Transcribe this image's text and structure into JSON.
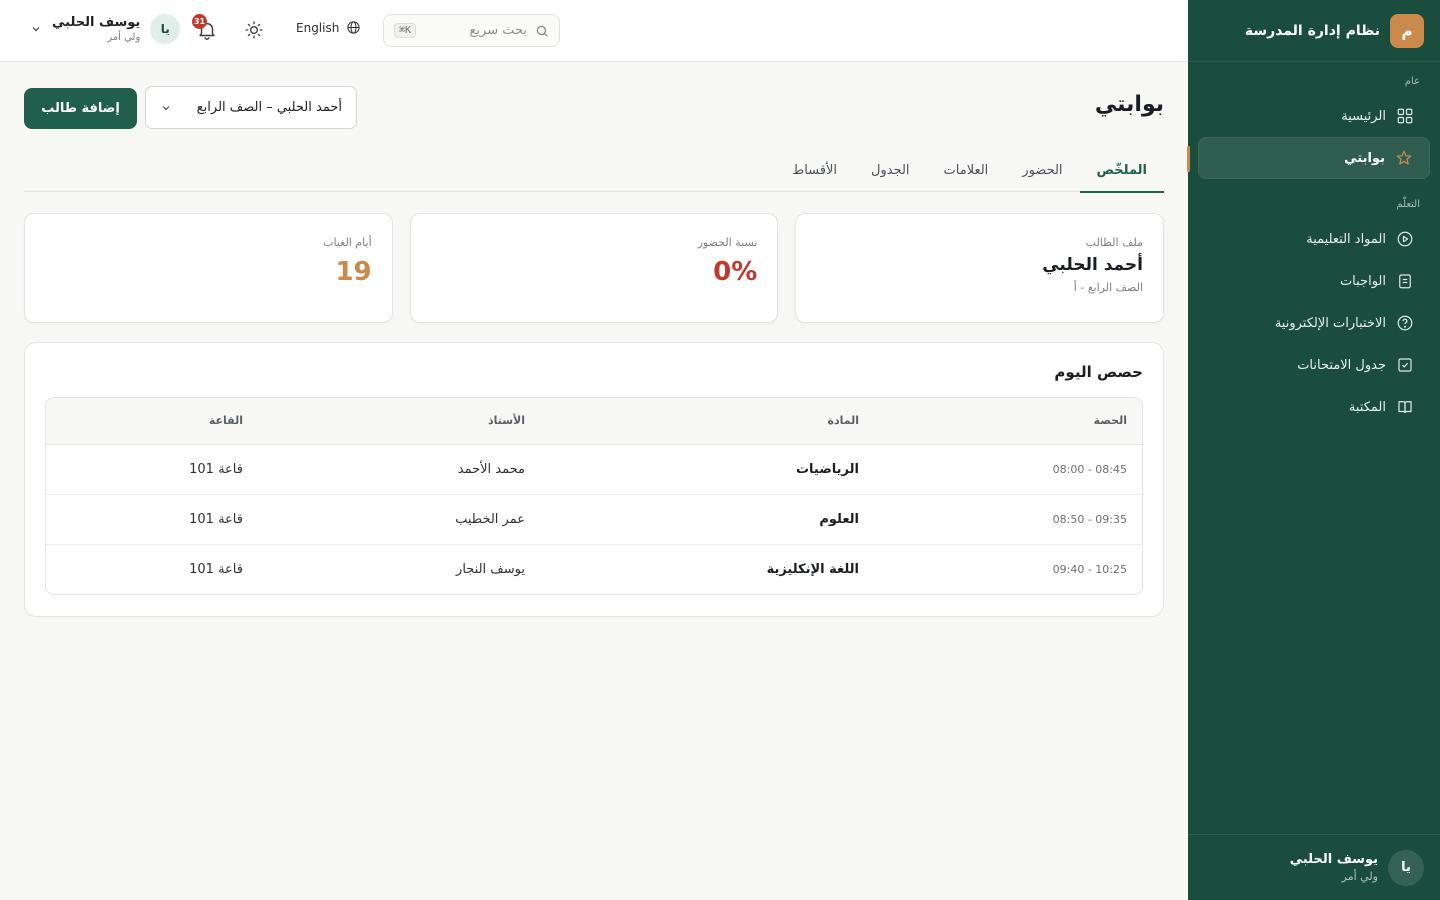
{
  "brand": {
    "logo_letter": "م",
    "title": "نظام إدارة المدرسة"
  },
  "sidebar": {
    "sections": [
      {
        "label": "عام",
        "items": [
          {
            "label": "الرئيسية",
            "icon": "grid-icon"
          },
          {
            "label": "بوابتي",
            "icon": "star-icon",
            "active": true
          }
        ]
      },
      {
        "label": "التعلّم",
        "items": [
          {
            "label": "المواد التعليمية",
            "icon": "play-circle-icon"
          },
          {
            "label": "الواجبات",
            "icon": "clipboard-icon"
          },
          {
            "label": "الاختبارات الإلكترونية",
            "icon": "help-circle-icon"
          },
          {
            "label": "جدول الامتحانات",
            "icon": "check-square-icon"
          },
          {
            "label": "المكتبة",
            "icon": "book-icon"
          }
        ]
      }
    ],
    "footer": {
      "avatar": "يا",
      "name": "يوسف الحلبي",
      "role": "ولي أمر"
    }
  },
  "topbar": {
    "search_placeholder": "بحث سريع",
    "search_shortcut": "⌘K",
    "language": "English",
    "notifications_count": "31",
    "user": {
      "avatar": "يا",
      "name": "يوسف الحلبي",
      "role": "ولي أمر"
    }
  },
  "page": {
    "title": "بوابتي",
    "add_button": "إضافة طالب",
    "student_select": "أحمد الحلبي – الصف الرابع"
  },
  "tabs": [
    {
      "label": "الملخّص",
      "active": true
    },
    {
      "label": "الحضور"
    },
    {
      "label": "العلامات"
    },
    {
      "label": "الجدول"
    },
    {
      "label": "الأقساط"
    }
  ],
  "cards": {
    "profile": {
      "label": "ملف الطالب",
      "name": "أحمد الحلبي",
      "class": "الصف الرابع - أ"
    },
    "attendance": {
      "label": "نسبة الحضور",
      "value": "0%"
    },
    "absence": {
      "label": "أيام الغياب",
      "value": "19"
    }
  },
  "today": {
    "title": "حصص اليوم",
    "columns": [
      "الحصة",
      "المادة",
      "الأستاذ",
      "القاعة"
    ],
    "rows": [
      {
        "period": "08:00 - 08:45",
        "subject": "الرياضيات",
        "teacher": "محمد الأحمد",
        "room": "قاعة 101"
      },
      {
        "period": "08:50 - 09:35",
        "subject": "العلوم",
        "teacher": "عمر الخطيب",
        "room": "قاعة 101"
      },
      {
        "period": "09:40 - 10:25",
        "subject": "اللغة الإنكليزية",
        "teacher": "يوسف النجار",
        "room": "قاعة 101"
      }
    ]
  },
  "colors": {
    "sidebar_bg": "#1b4d3e",
    "accent": "#1f5f4b",
    "brand_amber": "#c98a4b",
    "danger": "#c0392b"
  }
}
